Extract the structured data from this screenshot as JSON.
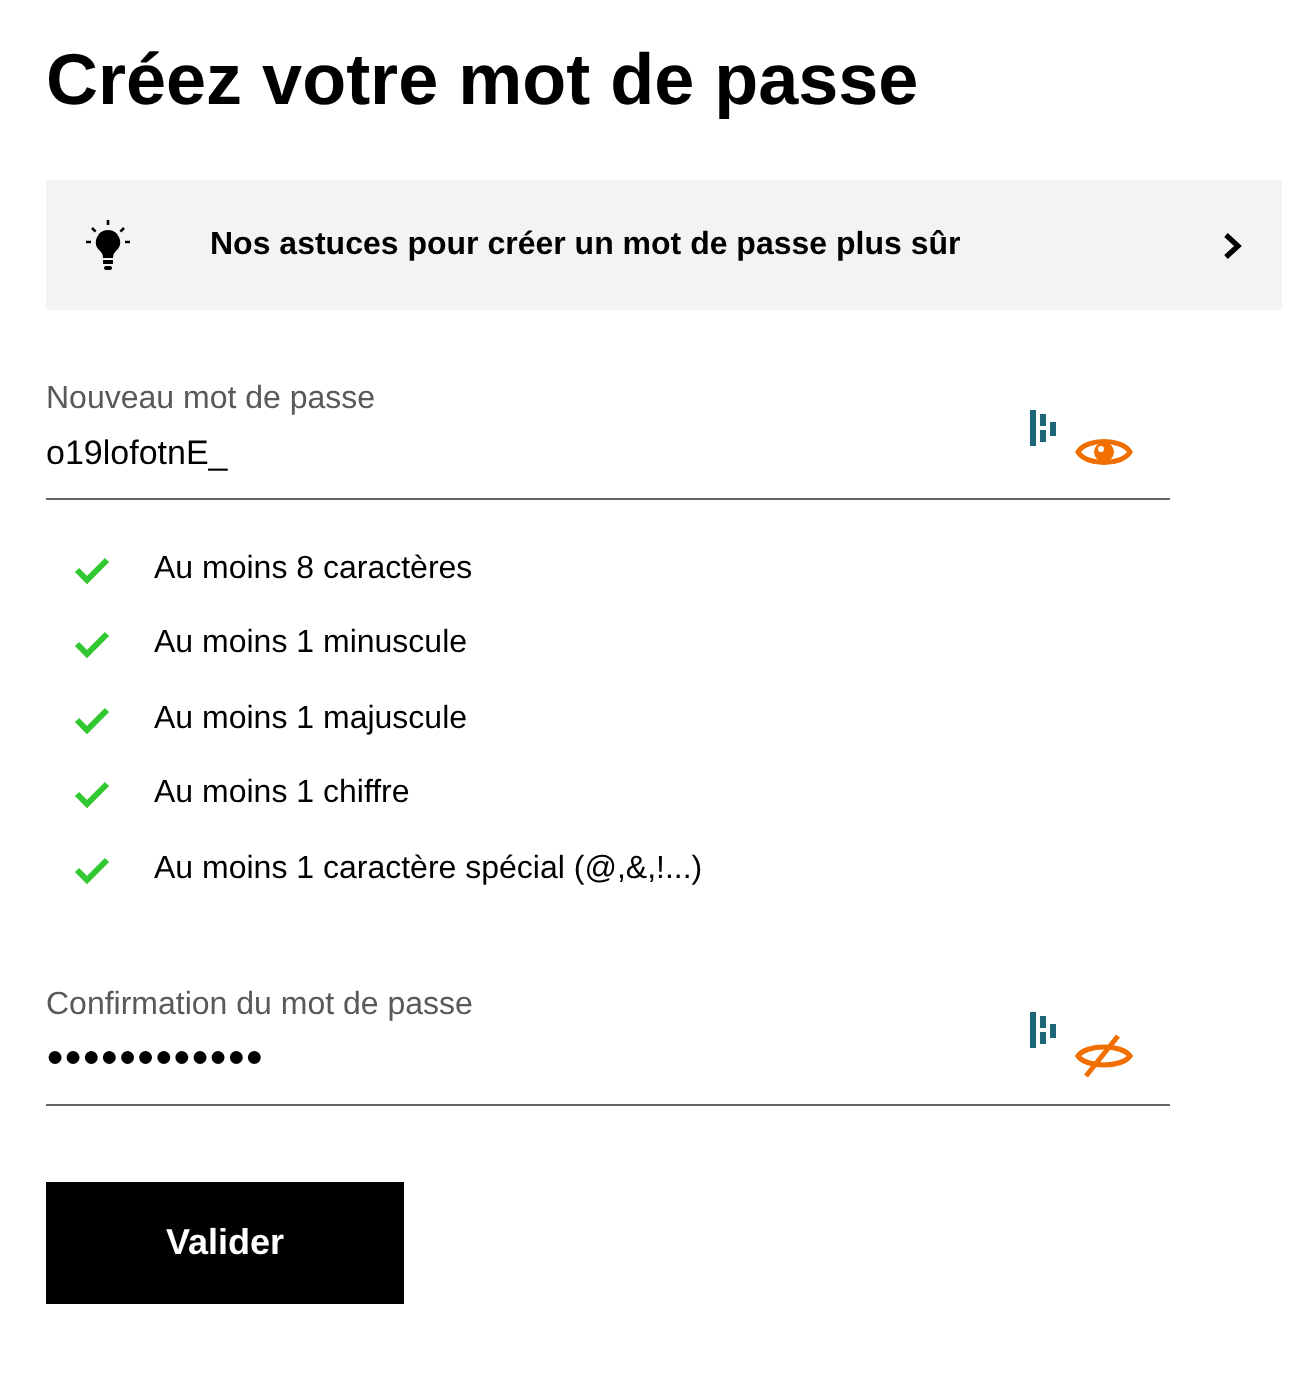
{
  "title": "Créez votre mot de passe",
  "tips_banner": {
    "text": "Nos astuces pour créer un mot de passe plus sûr"
  },
  "fields": [
    {
      "label": "Nouveau mot de passe",
      "value": "o19lofotnE_",
      "visible": true
    },
    {
      "label": "Confirmation du mot de passe",
      "value": "●●●●●●●●●●●●",
      "visible": false
    }
  ],
  "requirements": [
    {
      "text": "Au moins 8 caractères",
      "met": true
    },
    {
      "text": "Au moins 1 minuscule",
      "met": true
    },
    {
      "text": "Au moins 1 majuscule",
      "met": true
    },
    {
      "text": "Au moins 1 chiffre",
      "met": true
    },
    {
      "text": "Au moins 1 caractère spécial (@,&,!...)",
      "met": true
    }
  ],
  "submit_button": "Valider"
}
